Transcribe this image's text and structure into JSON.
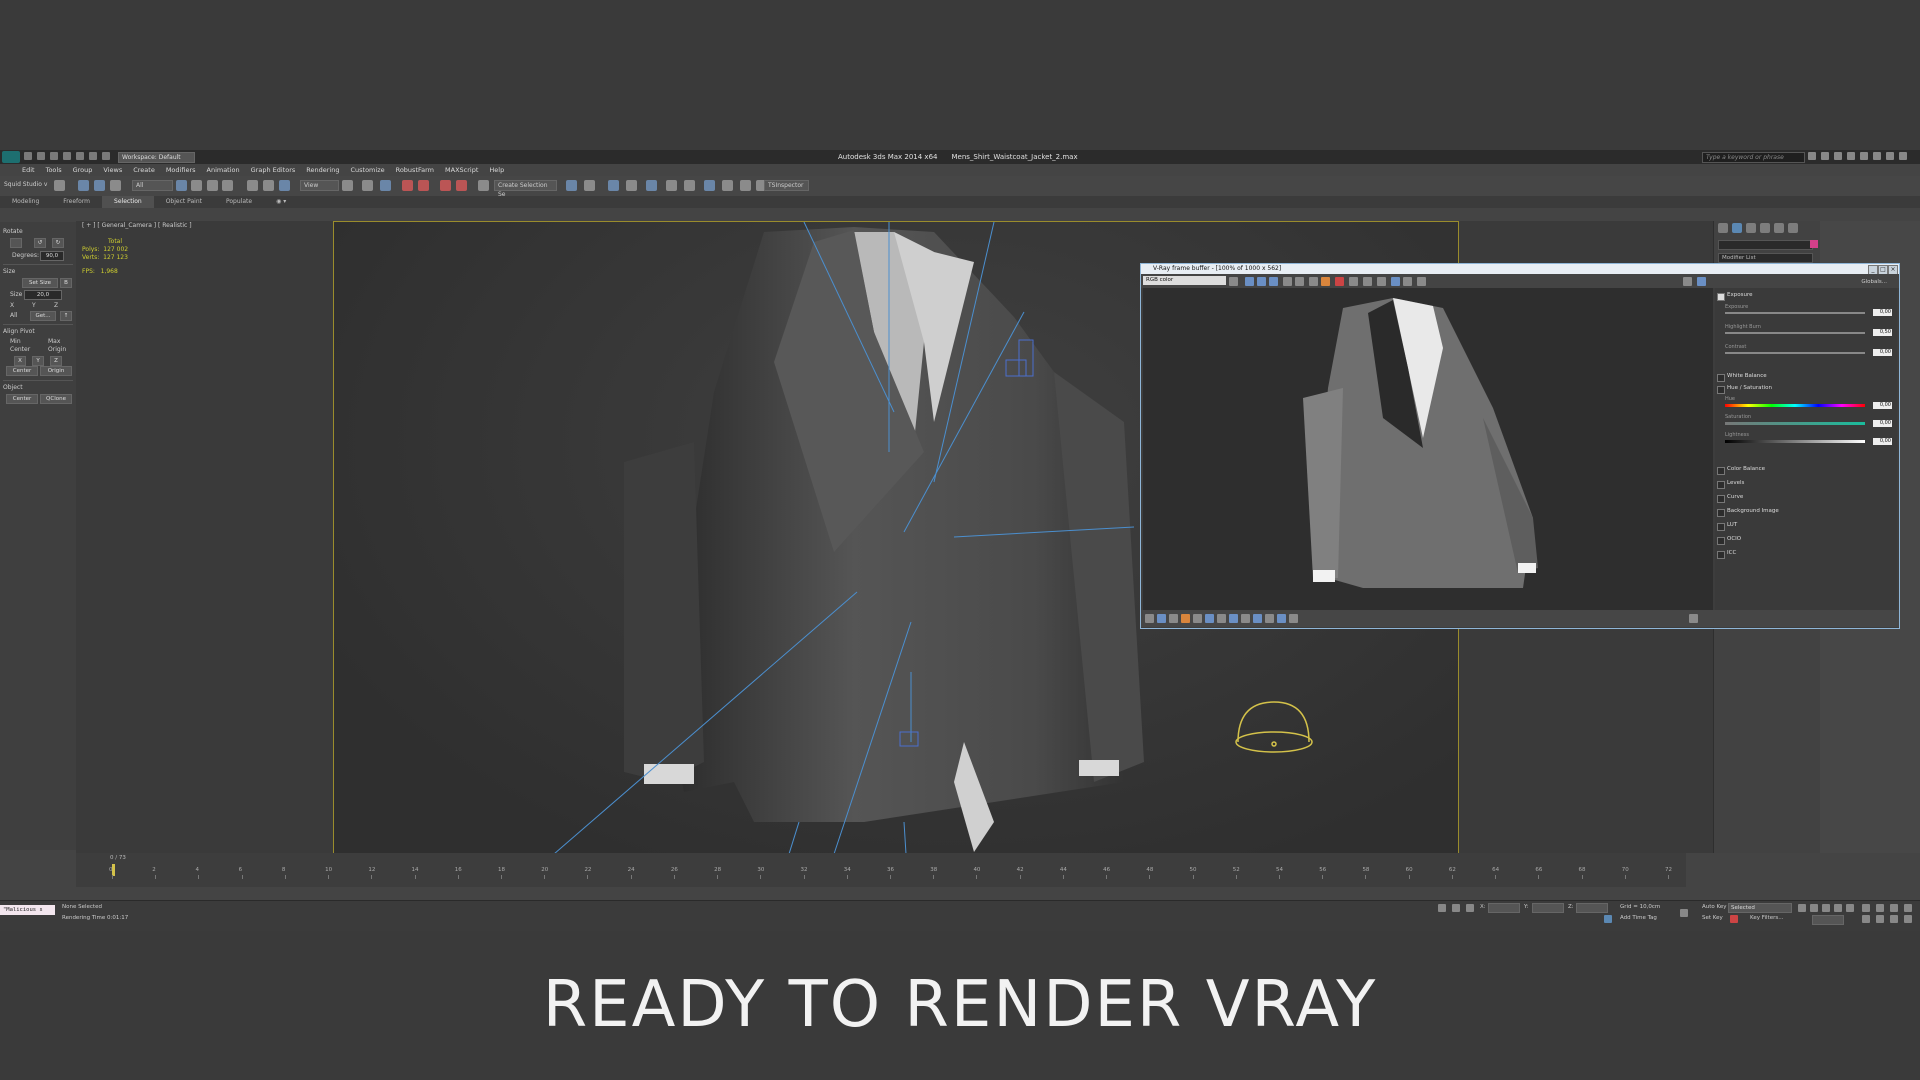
{
  "app": {
    "workspace": "Workspace: Default",
    "title_app": "Autodesk 3ds Max  2014 x64",
    "title_file": "Mens_Shirt_Waistcoat_Jacket_2.max",
    "search_placeholder": "Type a keyword or phrase"
  },
  "menu": [
    "Edit",
    "Tools",
    "Group",
    "Views",
    "Create",
    "Modifiers",
    "Animation",
    "Graph Editors",
    "Rendering",
    "Customize",
    "RobustFarm",
    "MAXScript",
    "Help"
  ],
  "toolbar": {
    "workspace_label": "Squid Studio v",
    "filter": "All",
    "ref_coord": "View",
    "selection_set": "Create Selection Se",
    "plugin": "TSInspector"
  },
  "ribbon": {
    "tabs": [
      "Modeling",
      "Freeform",
      "Selection",
      "Object Paint",
      "Populate"
    ],
    "active": "Selection"
  },
  "left_panel": {
    "rotate": "Rotate",
    "degrees_label": "Degrees:",
    "degrees_value": "90,0",
    "size": "Size",
    "set_size": "Set Size",
    "size_label": "Size",
    "size_value": "20,0",
    "axes": [
      "X",
      "Y",
      "Z"
    ],
    "all": "All",
    "get": "Get...",
    "align_pivot": "Align Pivot",
    "min": "Min",
    "max": "Max",
    "center": "Center",
    "origin": "Origin",
    "center_btn": "Center",
    "origin_btn": "Origin",
    "object": "Object",
    "obj_center": "Center",
    "qclone": "QClone"
  },
  "viewport": {
    "label": "[ + ] [ General_Camera ] [ Realistic ]",
    "total": "Total",
    "polys_label": "Polys:",
    "polys_value": "127 002",
    "verts_label": "Verts:",
    "verts_value": "127 123",
    "fps_label": "FPS:",
    "fps_value": "1,968"
  },
  "command_panel": {
    "modifier_list": "Modifier List",
    "swatch_color": "#d4408a"
  },
  "vfb": {
    "title": "V-Ray frame buffer - [100% of 1000 x 562]",
    "channel": "RGB color",
    "globals": "Globals...",
    "exposure": "Exposure",
    "exposure_sub": "Exposure",
    "exposure_val": "0,00",
    "highlight_burn": "Highlight Burn",
    "highlight_val": "0,50",
    "contrast": "Contrast",
    "contrast_val": "0,00",
    "white_balance": "White Balance",
    "hue_saturation": "Hue / Saturation",
    "hue": "Hue",
    "hue_val": "0,00",
    "saturation": "Saturation",
    "saturation_val": "0,00",
    "lightness": "Lightness",
    "lightness_val": "0,00",
    "layers": [
      "Color Balance",
      "Levels",
      "Curve",
      "Background Image",
      "LUT",
      "OCIO",
      "ICC"
    ]
  },
  "timeline": {
    "frame": "0 / 73",
    "ticks": [
      "0",
      "2",
      "4",
      "6",
      "8",
      "10",
      "12",
      "14",
      "16",
      "18",
      "20",
      "22",
      "24",
      "26",
      "28",
      "30",
      "32",
      "34",
      "36",
      "38",
      "40",
      "42",
      "44",
      "46",
      "48",
      "50",
      "52",
      "54",
      "56",
      "58",
      "60",
      "62",
      "64",
      "66",
      "68",
      "70",
      "72"
    ]
  },
  "status": {
    "maxscript": "\"Malicious s",
    "selection": "None Selected",
    "render_time": "Rendering Time  0:01:17",
    "x": "X:",
    "y": "Y:",
    "z": "Z:",
    "grid": "Grid = 10,0cm",
    "add_time_tag": "Add Time Tag",
    "auto_key": "Auto Key",
    "selected": "Selected",
    "set_key": "Set Key",
    "key_filters": "Key Filters..."
  },
  "caption": "READY TO RENDER  VRAY"
}
